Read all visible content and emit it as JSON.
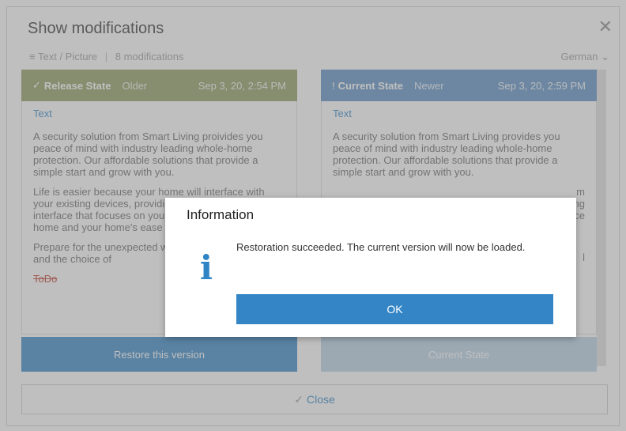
{
  "dialog": {
    "title": "Show modifications",
    "subtitle_category": "Text / Picture",
    "subtitle_count": "8 modifications",
    "language": "German"
  },
  "left_panel": {
    "state": "Release State",
    "age": "Older",
    "date": "Sep 3, 20, 2:54 PM",
    "section": "Text",
    "paragraphs": [
      "A security solution from Smart Living proivides you peace of mind with industry leading whole-home protection. Our affordable solutions that provide a simple start and grow with you.",
      "Life is easier because your home will interface with your existing devices, providing a secure and intelligent interface that focuses on your comfort while you're home and your home's ease when you are away.",
      "Prepare for the unexpected with best in class brands and the choice of"
    ],
    "todo": "ToDo",
    "button": "Restore this version"
  },
  "right_panel": {
    "state": "Current State",
    "age": "Newer",
    "date": "Sep 3, 20, 2:59 PM",
    "section": "Text",
    "paragraphs": [
      "A security solution from Smart Living provides you peace of mind with industry leading whole-home protection. Our affordable solutions that provide a simple start and grow with you.",
      "m",
      "ng",
      "ce",
      "l"
    ],
    "button": "Current State"
  },
  "footer": {
    "close_label": "Close"
  },
  "modal": {
    "title": "Information",
    "message": "Restoration succeeded. The current version will now be loaded.",
    "ok_label": "OK",
    "icon": "info-icon"
  },
  "colors": {
    "release_header": "#8e9a5f",
    "current_header": "#5a8fc4",
    "accent": "#3385c6"
  }
}
